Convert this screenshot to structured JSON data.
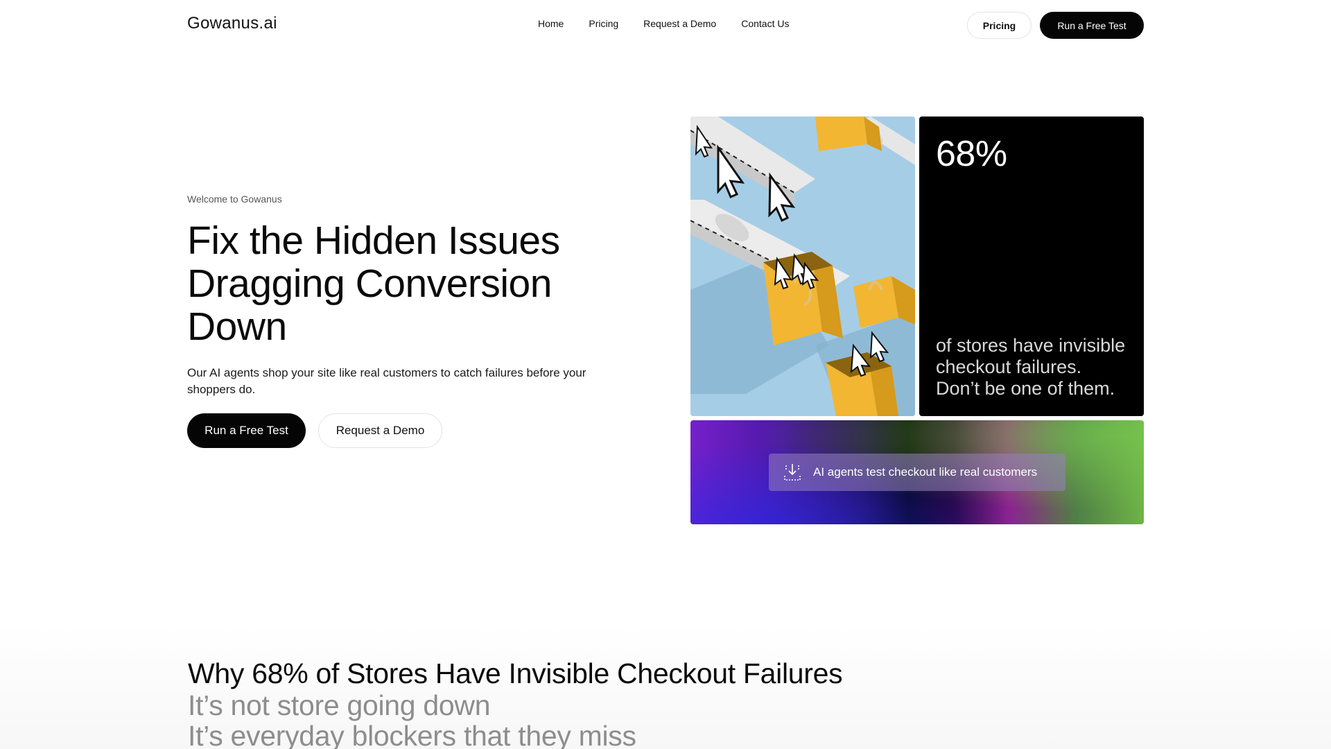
{
  "nav": {
    "logo": "Gowanus.ai",
    "links": [
      "Home",
      "Pricing",
      "Request a Demo",
      "Contact Us"
    ],
    "pricing_button": "Pricing",
    "cta_button": "Run a Free Test"
  },
  "hero": {
    "eyebrow": "Welcome to Gowanus",
    "title": "Fix the Hidden Issues Dragging Conversion Down",
    "subtitle": "Our AI agents shop your site like real customers to catch failures before your shoppers do.",
    "primary_button": "Run a Free Test",
    "secondary_button": "Request a Demo"
  },
  "tiles": {
    "stat_value": "68%",
    "stat_text": "of stores have invisible checkout failures. Don’t be one of them.",
    "banner_icon": "cursor-drop-icon",
    "banner_text": "AI agents test checkout like real customers"
  },
  "why": {
    "title": "Why 68% of Stores Have Invisible Checkout Failures",
    "line1": "It’s not store going down",
    "line2": "It’s everyday blockers that they miss"
  },
  "colors": {
    "primary": "#050505",
    "stat_bg": "#000000",
    "muted_text": "#8d8d8d",
    "image_bg": "#a9cfe8",
    "bag_yellow": "#f2b632"
  }
}
